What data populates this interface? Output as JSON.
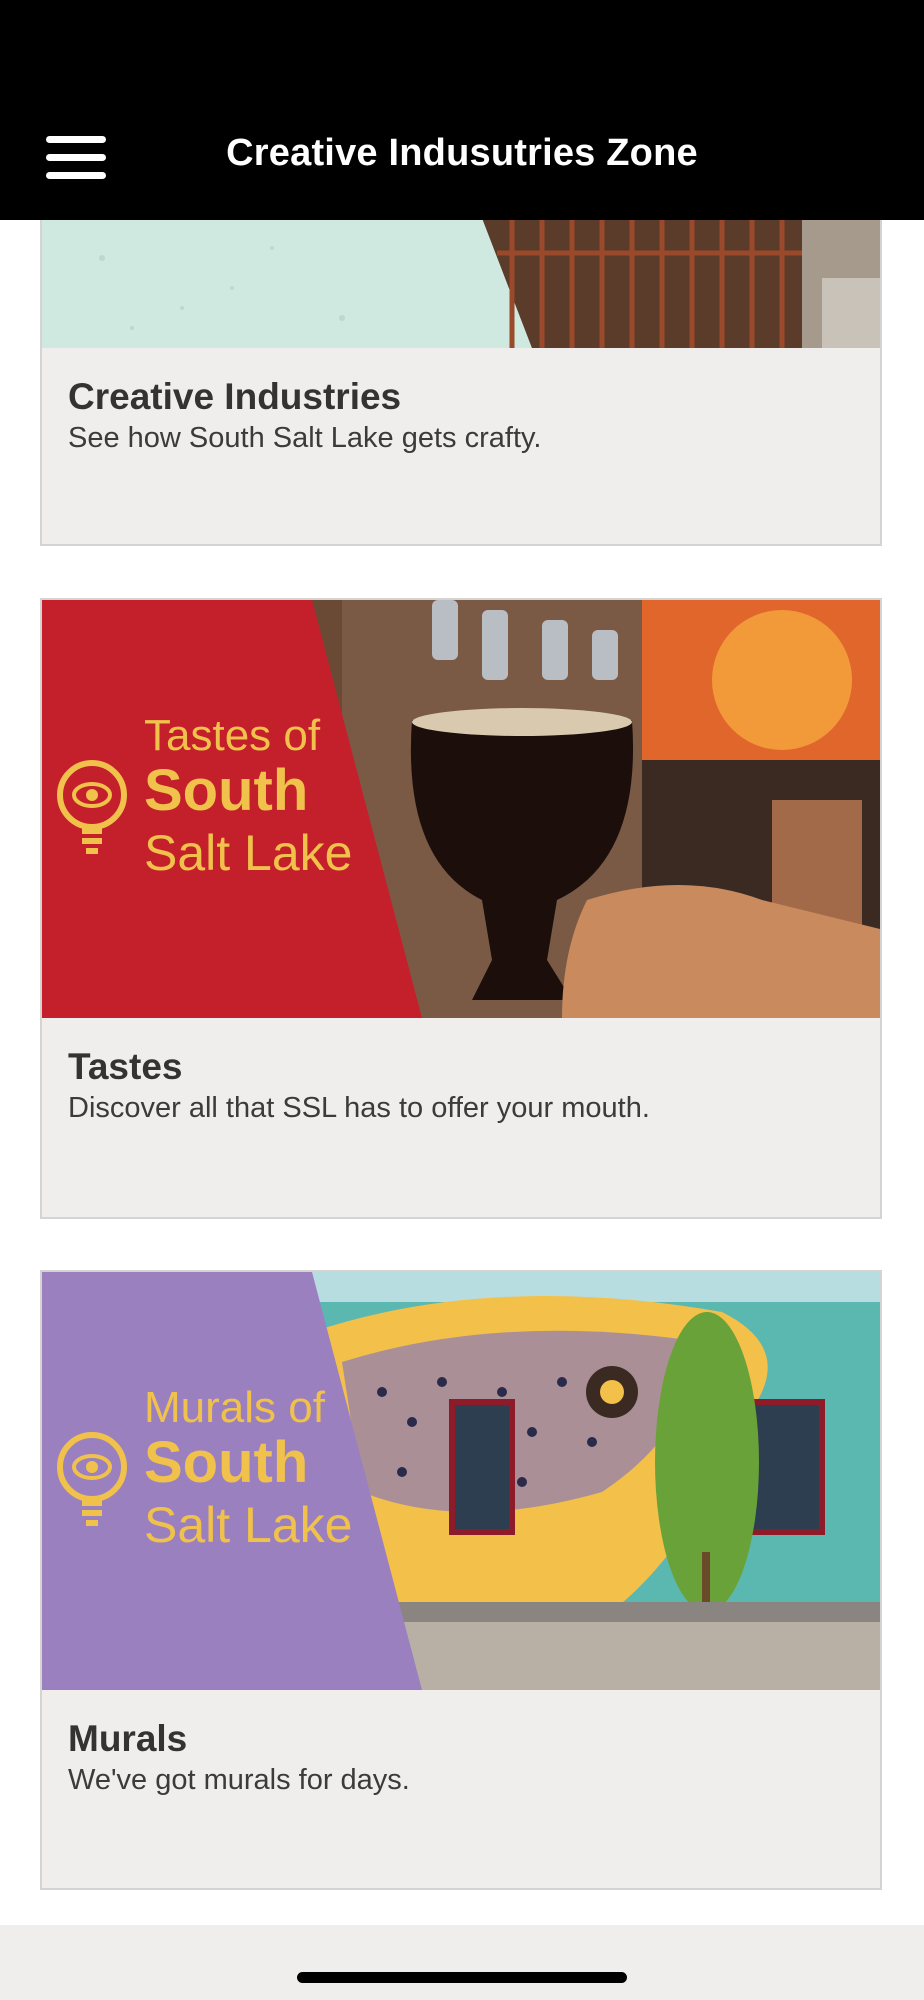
{
  "header": {
    "title": "Creative Indusutries Zone",
    "menu_icon": "hamburger-menu-icon"
  },
  "cards": [
    {
      "heading": "Creative Industries",
      "description": "See how South Salt Lake gets crafty.",
      "banner": {
        "theme_color": "#cfe8e0"
      }
    },
    {
      "heading": "Tastes",
      "description": "Discover all that SSL has to offer your mouth.",
      "banner": {
        "theme_color": "#c4202b",
        "logo_line1": "Tastes of",
        "logo_line2": "South",
        "logo_line3": "Salt Lake",
        "logo_icon": "lightbulb-eye-icon"
      }
    },
    {
      "heading": "Murals",
      "description": "We've got murals for days.",
      "banner": {
        "theme_color": "#9b80c0",
        "logo_line1": "Murals of",
        "logo_line2": "South",
        "logo_line3": "Salt Lake",
        "logo_icon": "lightbulb-eye-icon"
      }
    }
  ],
  "colors": {
    "header_bg": "#000000",
    "logo_gold": "#f0c14b",
    "card_bg": "#efeeec"
  }
}
